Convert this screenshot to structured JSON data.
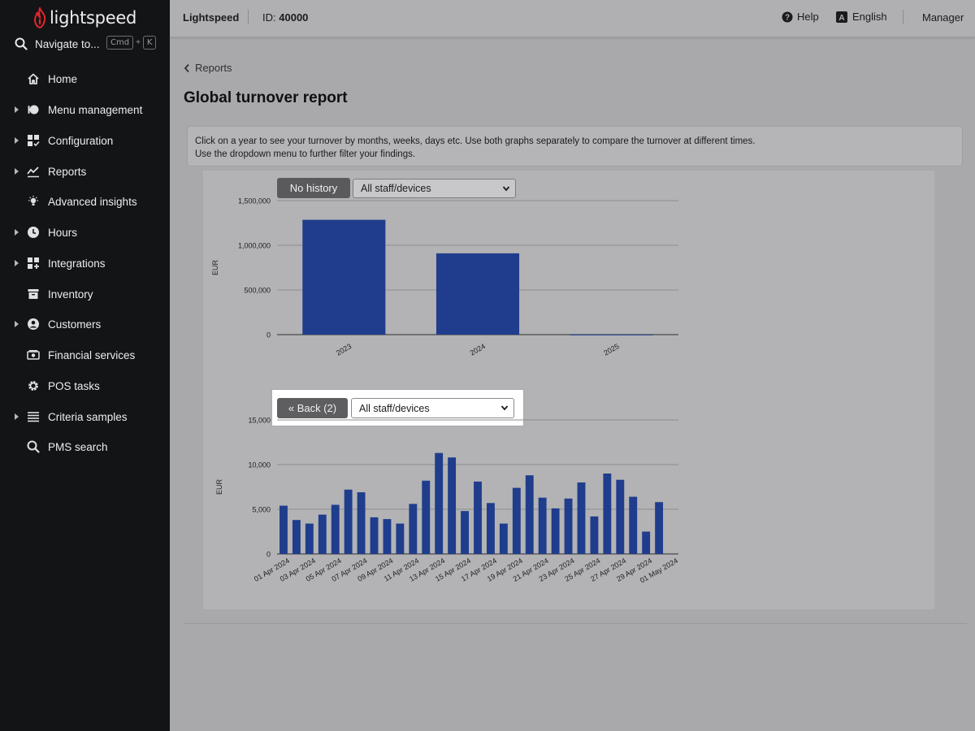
{
  "sidebar": {
    "logo_text": "lightspeed",
    "navigate": {
      "label": "Navigate to...",
      "key1": "Cmd",
      "plus": "+",
      "key2": "K"
    },
    "items": [
      {
        "label": "Home",
        "icon": "home-icon",
        "expandable": false
      },
      {
        "label": "Menu management",
        "icon": "menu-management-icon",
        "expandable": true
      },
      {
        "label": "Configuration",
        "icon": "configuration-icon",
        "expandable": true
      },
      {
        "label": "Reports",
        "icon": "reports-icon",
        "expandable": true
      },
      {
        "label": "Advanced insights",
        "icon": "lightbulb-icon",
        "expandable": false
      },
      {
        "label": "Hours",
        "icon": "clock-icon",
        "expandable": true
      },
      {
        "label": "Integrations",
        "icon": "integrations-icon",
        "expandable": true
      },
      {
        "label": "Inventory",
        "icon": "inventory-icon",
        "expandable": false
      },
      {
        "label": "Customers",
        "icon": "customer-icon",
        "expandable": true
      },
      {
        "label": "Financial services",
        "icon": "money-icon",
        "expandable": false
      },
      {
        "label": "POS tasks",
        "icon": "gear-icon",
        "expandable": false
      },
      {
        "label": "Criteria samples",
        "icon": "list-icon",
        "expandable": true
      },
      {
        "label": "PMS search",
        "icon": "search-icon",
        "expandable": false
      }
    ]
  },
  "topbar": {
    "brand": "Lightspeed",
    "id_label": "ID:",
    "id_value": "40000",
    "help": "Help",
    "language": "English",
    "user": "Manager"
  },
  "breadcrumb": "Reports",
  "page_title": "Global turnover report",
  "info": {
    "line1": "Click on a year to see your turnover by months, weeks, days etc. Use both graphs separately to compare the turnover at different times.",
    "line2": "Use the dropdown menu to further filter your findings."
  },
  "chart1_controls": {
    "button": "No history",
    "select": "All staff/devices"
  },
  "chart2_controls": {
    "button": "« Back (2)",
    "select": "All staff/devices"
  },
  "colors": {
    "bar": "#1f3d8c",
    "sidebar": "#131416",
    "brand_red": "#e0262c"
  },
  "chart_data": [
    {
      "type": "bar",
      "ylabel": "EUR",
      "ylim": [
        0,
        1500000
      ],
      "yticks": [
        "0",
        "500,000",
        "1,000,000",
        "1,500,000"
      ],
      "categories": [
        "2023",
        "2024",
        "2025"
      ],
      "values": [
        1285000,
        910000,
        2000
      ],
      "grid": true
    },
    {
      "type": "bar",
      "ylabel": "EUR",
      "ylim": [
        0,
        15000
      ],
      "yticks": [
        "0",
        "5,000",
        "10,000",
        "15,000"
      ],
      "categories": [
        "01 Apr 2024",
        "02 Apr 2024",
        "03 Apr 2024",
        "04 Apr 2024",
        "05 Apr 2024",
        "06 Apr 2024",
        "07 Apr 2024",
        "08 Apr 2024",
        "09 Apr 2024",
        "10 Apr 2024",
        "11 Apr 2024",
        "12 Apr 2024",
        "13 Apr 2024",
        "14 Apr 2024",
        "15 Apr 2024",
        "16 Apr 2024",
        "17 Apr 2024",
        "18 Apr 2024",
        "19 Apr 2024",
        "20 Apr 2024",
        "21 Apr 2024",
        "22 Apr 2024",
        "23 Apr 2024",
        "24 Apr 2024",
        "25 Apr 2024",
        "26 Apr 2024",
        "27 Apr 2024",
        "28 Apr 2024",
        "29 Apr 2024",
        "30 Apr 2024",
        "01 May 2024"
      ],
      "tick_labels": [
        "01 Apr 2024",
        "03 Apr 2024",
        "05 Apr 2024",
        "07 Apr 2024",
        "09 Apr 2024",
        "11 Apr 2024",
        "13 Apr 2024",
        "15 Apr 2024",
        "17 Apr 2024",
        "19 Apr 2024",
        "21 Apr 2024",
        "23 Apr 2024",
        "25 Apr 2024",
        "27 Apr 2024",
        "29 Apr 2024",
        "01 May 2024"
      ],
      "values": [
        5400,
        3800,
        3400,
        4400,
        5500,
        7200,
        6900,
        4100,
        3900,
        3400,
        5600,
        8200,
        11300,
        10800,
        4800,
        8100,
        5700,
        3400,
        7400,
        8800,
        6300,
        5100,
        6200,
        8000,
        4200,
        9000,
        8300,
        6400,
        2500,
        5800,
        0
      ],
      "grid": true
    }
  ]
}
